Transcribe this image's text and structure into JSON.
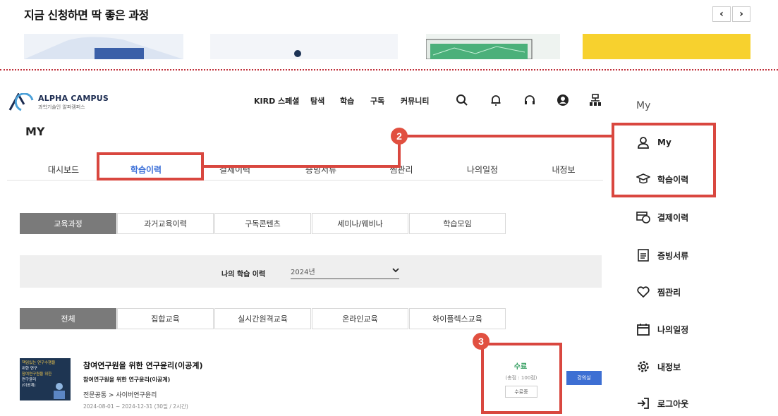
{
  "promo": {
    "title": "지금 신청하면 딱 좋은 과정",
    "prev_icon": "chevron-left-icon",
    "next_icon": "chevron-right-icon"
  },
  "header": {
    "logo_title": "ALPHA CAMPUS",
    "logo_subtitle": "과학기술인 알파캠퍼스",
    "nav": [
      "KIRD 스페셜",
      "탐색",
      "학습",
      "구독",
      "커뮤니티"
    ],
    "icons": [
      "search-icon",
      "bell-icon",
      "headset-icon",
      "user-circle-icon",
      "sitemap-icon"
    ]
  },
  "page": {
    "title": "MY",
    "tabs": [
      {
        "label": "대시보드",
        "active": false
      },
      {
        "label": "학습이력",
        "active": true
      },
      {
        "label": "결제이력",
        "active": false
      },
      {
        "label": "증빙서류",
        "active": false
      },
      {
        "label": "찜관리",
        "active": false
      },
      {
        "label": "나의일정",
        "active": false
      },
      {
        "label": "내정보",
        "active": false
      }
    ],
    "type_buttons": [
      "교육과정",
      "과거교육이력",
      "구독콘텐츠",
      "세미나/웨비나",
      "학습모임"
    ],
    "filter_label": "나의 학습 이력",
    "filter_value": "2024년",
    "mode_buttons": [
      "전체",
      "집합교육",
      "실시간원격교육",
      "온라인교육",
      "하이플렉스교육"
    ]
  },
  "course": {
    "thumb_lines": [
      "책임있는 연구수행을",
      "위한 연구",
      "참여연구원을 위한",
      "연구윤리",
      "(이공계)"
    ],
    "title": "참여연구원을 위한 연구윤리(이공계)",
    "subtitle": "참여연구원을 위한 연구윤리(이공계)",
    "category": "전문공통 > 사이버연구윤리",
    "dates": "2024-08-01 ~ 2024-12-31 (30일 / 2시간)",
    "status": "수료",
    "score": "(총점 : 100점)",
    "cert_button": "수료증",
    "classroom_button": "강의실"
  },
  "side_menu": {
    "title": "My",
    "items": [
      {
        "label": "My",
        "icon": "user-icon"
      },
      {
        "label": "학습이력",
        "icon": "graduation-cap-icon"
      },
      {
        "label": "결제이력",
        "icon": "payment-icon"
      },
      {
        "label": "증빙서류",
        "icon": "document-icon"
      },
      {
        "label": "찜관리",
        "icon": "heart-icon"
      },
      {
        "label": "나의일정",
        "icon": "calendar-icon"
      },
      {
        "label": "내정보",
        "icon": "gear-icon"
      },
      {
        "label": "로그아웃",
        "icon": "logout-icon"
      }
    ]
  },
  "annotations": {
    "badge_2": "2",
    "badge_3": "3",
    "highlight_color": "#d9473f"
  },
  "colors": {
    "accent": "#3b6fd8",
    "success": "#2d9b5b",
    "active_button": "#7a7a7a"
  }
}
